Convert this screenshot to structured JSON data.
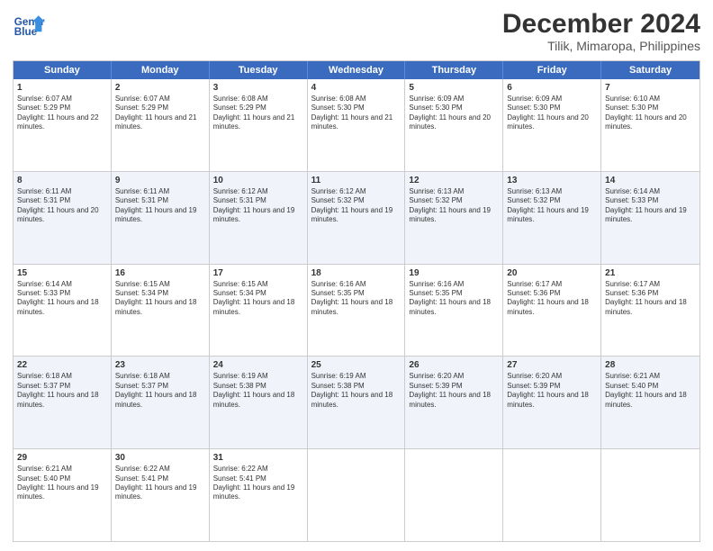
{
  "header": {
    "logo_line1": "General",
    "logo_line2": "Blue",
    "month": "December 2024",
    "location": "Tilik, Mimaropa, Philippines"
  },
  "days": [
    "Sunday",
    "Monday",
    "Tuesday",
    "Wednesday",
    "Thursday",
    "Friday",
    "Saturday"
  ],
  "weeks": [
    [
      {
        "day": "1",
        "sunrise": "6:07 AM",
        "sunset": "5:29 PM",
        "daylight": "11 hours and 22 minutes."
      },
      {
        "day": "2",
        "sunrise": "6:07 AM",
        "sunset": "5:29 PM",
        "daylight": "11 hours and 21 minutes."
      },
      {
        "day": "3",
        "sunrise": "6:08 AM",
        "sunset": "5:29 PM",
        "daylight": "11 hours and 21 minutes."
      },
      {
        "day": "4",
        "sunrise": "6:08 AM",
        "sunset": "5:30 PM",
        "daylight": "11 hours and 21 minutes."
      },
      {
        "day": "5",
        "sunrise": "6:09 AM",
        "sunset": "5:30 PM",
        "daylight": "11 hours and 20 minutes."
      },
      {
        "day": "6",
        "sunrise": "6:09 AM",
        "sunset": "5:30 PM",
        "daylight": "11 hours and 20 minutes."
      },
      {
        "day": "7",
        "sunrise": "6:10 AM",
        "sunset": "5:30 PM",
        "daylight": "11 hours and 20 minutes."
      }
    ],
    [
      {
        "day": "8",
        "sunrise": "6:11 AM",
        "sunset": "5:31 PM",
        "daylight": "11 hours and 20 minutes."
      },
      {
        "day": "9",
        "sunrise": "6:11 AM",
        "sunset": "5:31 PM",
        "daylight": "11 hours and 19 minutes."
      },
      {
        "day": "10",
        "sunrise": "6:12 AM",
        "sunset": "5:31 PM",
        "daylight": "11 hours and 19 minutes."
      },
      {
        "day": "11",
        "sunrise": "6:12 AM",
        "sunset": "5:32 PM",
        "daylight": "11 hours and 19 minutes."
      },
      {
        "day": "12",
        "sunrise": "6:13 AM",
        "sunset": "5:32 PM",
        "daylight": "11 hours and 19 minutes."
      },
      {
        "day": "13",
        "sunrise": "6:13 AM",
        "sunset": "5:32 PM",
        "daylight": "11 hours and 19 minutes."
      },
      {
        "day": "14",
        "sunrise": "6:14 AM",
        "sunset": "5:33 PM",
        "daylight": "11 hours and 19 minutes."
      }
    ],
    [
      {
        "day": "15",
        "sunrise": "6:14 AM",
        "sunset": "5:33 PM",
        "daylight": "11 hours and 18 minutes."
      },
      {
        "day": "16",
        "sunrise": "6:15 AM",
        "sunset": "5:34 PM",
        "daylight": "11 hours and 18 minutes."
      },
      {
        "day": "17",
        "sunrise": "6:15 AM",
        "sunset": "5:34 PM",
        "daylight": "11 hours and 18 minutes."
      },
      {
        "day": "18",
        "sunrise": "6:16 AM",
        "sunset": "5:35 PM",
        "daylight": "11 hours and 18 minutes."
      },
      {
        "day": "19",
        "sunrise": "6:16 AM",
        "sunset": "5:35 PM",
        "daylight": "11 hours and 18 minutes."
      },
      {
        "day": "20",
        "sunrise": "6:17 AM",
        "sunset": "5:36 PM",
        "daylight": "11 hours and 18 minutes."
      },
      {
        "day": "21",
        "sunrise": "6:17 AM",
        "sunset": "5:36 PM",
        "daylight": "11 hours and 18 minutes."
      }
    ],
    [
      {
        "day": "22",
        "sunrise": "6:18 AM",
        "sunset": "5:37 PM",
        "daylight": "11 hours and 18 minutes."
      },
      {
        "day": "23",
        "sunrise": "6:18 AM",
        "sunset": "5:37 PM",
        "daylight": "11 hours and 18 minutes."
      },
      {
        "day": "24",
        "sunrise": "6:19 AM",
        "sunset": "5:38 PM",
        "daylight": "11 hours and 18 minutes."
      },
      {
        "day": "25",
        "sunrise": "6:19 AM",
        "sunset": "5:38 PM",
        "daylight": "11 hours and 18 minutes."
      },
      {
        "day": "26",
        "sunrise": "6:20 AM",
        "sunset": "5:39 PM",
        "daylight": "11 hours and 18 minutes."
      },
      {
        "day": "27",
        "sunrise": "6:20 AM",
        "sunset": "5:39 PM",
        "daylight": "11 hours and 18 minutes."
      },
      {
        "day": "28",
        "sunrise": "6:21 AM",
        "sunset": "5:40 PM",
        "daylight": "11 hours and 18 minutes."
      }
    ],
    [
      {
        "day": "29",
        "sunrise": "6:21 AM",
        "sunset": "5:40 PM",
        "daylight": "11 hours and 19 minutes."
      },
      {
        "day": "30",
        "sunrise": "6:22 AM",
        "sunset": "5:41 PM",
        "daylight": "11 hours and 19 minutes."
      },
      {
        "day": "31",
        "sunrise": "6:22 AM",
        "sunset": "5:41 PM",
        "daylight": "11 hours and 19 minutes."
      },
      null,
      null,
      null,
      null
    ]
  ]
}
